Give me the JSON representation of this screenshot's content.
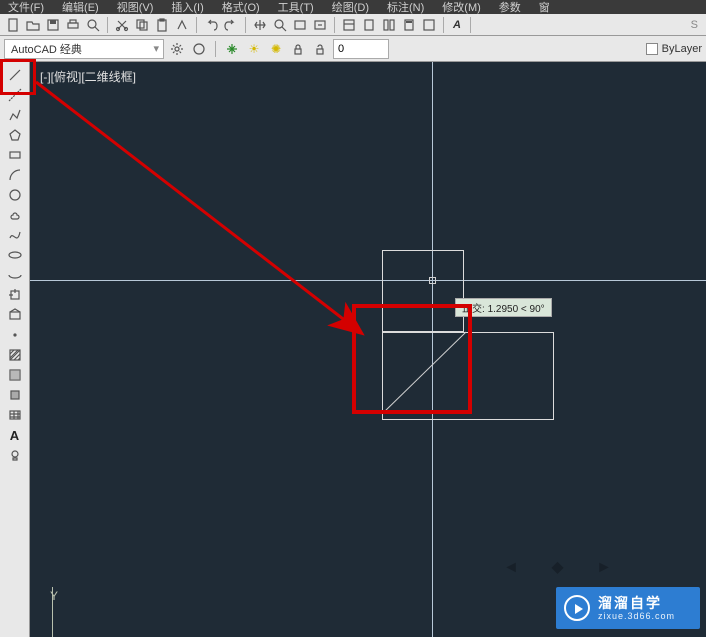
{
  "menu": [
    "文件(F)",
    "编辑(E)",
    "视图(V)",
    "插入(I)",
    "格式(O)",
    "工具(T)",
    "绘图(D)",
    "标注(N)",
    "修改(M)",
    "参数",
    "窗"
  ],
  "toolbar_row1": {
    "new": "new",
    "open": "open",
    "save": "save",
    "print": "print",
    "undo": "undo",
    "redo": "redo",
    "cut": "cut",
    "copy": "copy",
    "paste": "paste",
    "match": "match"
  },
  "workspace_label": "AutoCAD 经典",
  "layer_current": "0",
  "bylayer_label": "ByLayer",
  "side_tools": {
    "line": "line",
    "xline": "xline",
    "polyline": "polyline",
    "polygon": "polygon",
    "rectangle": "rectangle",
    "arc": "arc",
    "circle": "circle",
    "revcloud": "revcloud",
    "spline": "spline",
    "ellipse": "ellipse",
    "ellipsearc": "ellipsearc",
    "insert": "insert",
    "block": "block",
    "point": "point",
    "hatch": "hatch",
    "gradient": "gradient",
    "region": "region",
    "table": "table",
    "text": "A",
    "addlight": "addlight"
  },
  "viewport_label": "[-][俯视][二维线框]",
  "tooltip_prefix": "正交",
  "tooltip_value": "1.2950 < 90°",
  "watermark_cn": "溜溜自学",
  "watermark_en": "zixue.3d66.com",
  "ucs": {
    "y": "Y"
  },
  "search_placeholder": "S"
}
